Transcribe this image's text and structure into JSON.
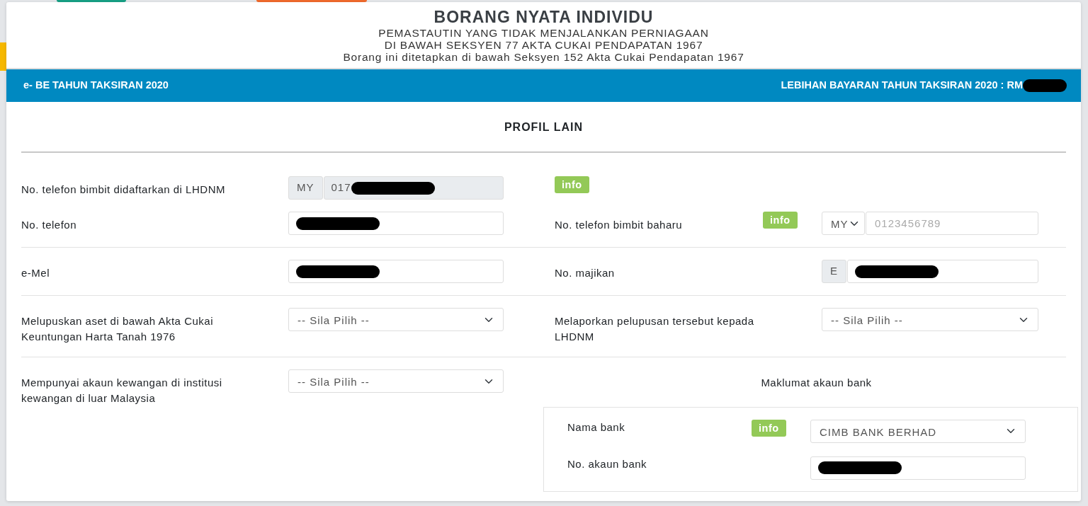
{
  "header": {
    "title": "BORANG NYATA INDIVIDU",
    "lines": [
      "PEMASTAUTIN YANG TIDAK MENJALANKAN PERNIAGAAN",
      "DI BAWAH SEKSYEN 77 AKTA CUKAI PENDAPATAN 1967",
      "Borang ini ditetapkan di bawah Seksyen 152 Akta Cukai Pendapatan 1967"
    ]
  },
  "banner": {
    "left": "e- BE TAHUN TAKSIRAN 2020",
    "right": "LEBIHAN BAYARAN TAHUN TAKSIRAN 2020 : RM",
    "right_redacted": true
  },
  "section_title": "PROFIL LAIN",
  "rows": [
    {
      "divider": false,
      "left": {
        "label": "No. telefon bimbit didaftarkan di LHDNM",
        "field": {
          "kind": "prefixed",
          "prefix": "MY",
          "value": "017",
          "redacted": true,
          "disabled": true
        }
      },
      "right": {
        "info": "info"
      }
    },
    {
      "divider": false,
      "left": {
        "label": "No. telefon",
        "field": {
          "kind": "text",
          "redacted": true
        }
      },
      "right": {
        "label": "No. telefon bimbit baharu",
        "info": "info",
        "field": {
          "kind": "phone",
          "option": "MY",
          "placeholder": "0123456789"
        }
      }
    },
    {
      "divider": true,
      "left": {
        "label": "e-Mel",
        "field": {
          "kind": "text",
          "redacted": true
        }
      },
      "right": {
        "label": "No. majikan",
        "field": {
          "kind": "prefixed",
          "prefix": "E",
          "redacted": true,
          "disabled": false
        }
      }
    },
    {
      "divider": true,
      "left": {
        "label": "Melupuskan aset di bawah Akta Cukai Keuntungan Harta Tanah 1976",
        "field": {
          "kind": "select",
          "value": "-- Sila Pilih --"
        }
      },
      "right": {
        "label": "Melaporkan pelupusan tersebut kepada LHDNM",
        "field": {
          "kind": "select",
          "value": "-- Sila Pilih --"
        }
      }
    },
    {
      "divider": true,
      "left": {
        "label": "Mempunyai akaun kewangan di institusi kewangan di luar Malaysia",
        "field": {
          "kind": "select",
          "value": "-- Sila Pilih --"
        }
      },
      "right": {
        "bank": {
          "title": "Maklumat akaun bank",
          "fields": [
            {
              "label": "Nama bank",
              "info": "info",
              "field": {
                "kind": "select",
                "value": "CIMB BANK BERHAD"
              }
            },
            {
              "label": "No. akaun bank",
              "field": {
                "kind": "text",
                "redacted": true
              }
            }
          ]
        }
      }
    }
  ]
}
